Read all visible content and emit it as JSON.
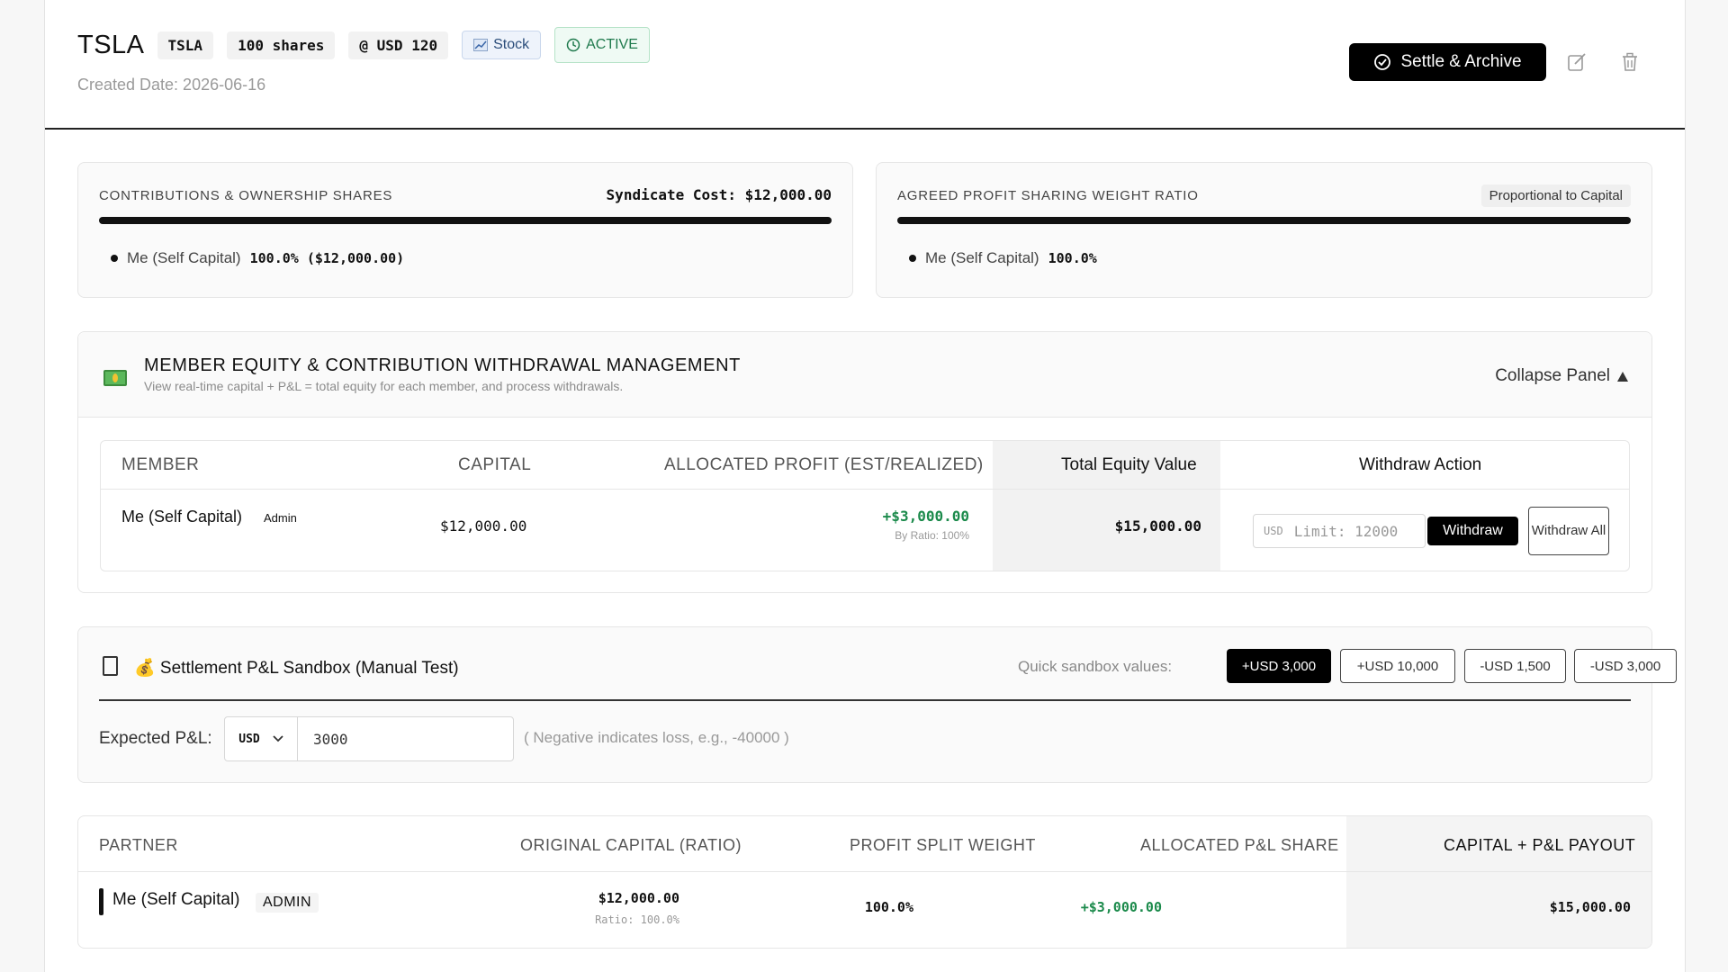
{
  "header": {
    "ticker": "TSLA",
    "chips": {
      "symbol": "TSLA",
      "shares": "100 shares",
      "price": "@ USD 120",
      "type": "Stock",
      "status": "ACTIVE"
    },
    "created": "Created Date: 2026-06-16",
    "settle_label": "Settle & Archive"
  },
  "contributions": {
    "label": "CONTRIBUTIONS & OWNERSHIP SHARES",
    "cost": "Syndicate Cost: $12,000.00",
    "member_name": "Me (Self Capital)",
    "member_value": "100.0% ($12,000.00)",
    "share_fraction": 1.0
  },
  "profit_ratio": {
    "label": "AGREED PROFIT SHARING WEIGHT RATIO",
    "badge": "Proportional to Capital",
    "member_name": "Me (Self Capital)",
    "member_value": "100.0%",
    "share_fraction": 1.0
  },
  "equity_panel": {
    "title": "MEMBER EQUITY & CONTRIBUTION WITHDRAWAL MANAGEMENT",
    "subtitle": "View real-time capital + P&L = total equity for each member, and process withdrawals.",
    "collapse_label": "Collapse Panel",
    "headers": {
      "member": "MEMBER",
      "capital": "CAPITAL",
      "profit": "ALLOCATED PROFIT (EST/REALIZED)",
      "equity": "Total Equity Value",
      "action": "Withdraw Action"
    },
    "row": {
      "member": "Me (Self Capital)",
      "role": "Admin",
      "capital": "$12,000.00",
      "profit": "+$3,000.00",
      "profit_note": "By Ratio: 100%",
      "equity": "$15,000.00",
      "input_currency": "USD",
      "input_placeholder": "Limit: 12000",
      "withdraw_label": "Withdraw",
      "withdraw_all_label": "Withdraw All"
    }
  },
  "sandbox": {
    "title": "💰 Settlement P&L Sandbox (Manual Test)",
    "quick_label": "Quick sandbox values:",
    "quick_values": [
      "+USD 3,000",
      "+USD 10,000",
      "-USD 1,500",
      "-USD 3,000"
    ],
    "expected_label": "Expected P&L:",
    "currency": "USD",
    "value": "3000",
    "hint": "( Negative indicates loss, e.g., -40000 )"
  },
  "partners": {
    "headers": {
      "partner": "PARTNER",
      "capital": "ORIGINAL CAPITAL (RATIO)",
      "weight": "PROFIT SPLIT WEIGHT",
      "share": "ALLOCATED P&L SHARE",
      "payout": "CAPITAL + P&L PAYOUT"
    },
    "row": {
      "partner": "Me (Self Capital)",
      "role": "ADMIN",
      "capital": "$12,000.00",
      "ratio": "Ratio: 100.0%",
      "weight": "100.0%",
      "share": "+$3,000.00",
      "payout": "$15,000.00"
    }
  }
}
